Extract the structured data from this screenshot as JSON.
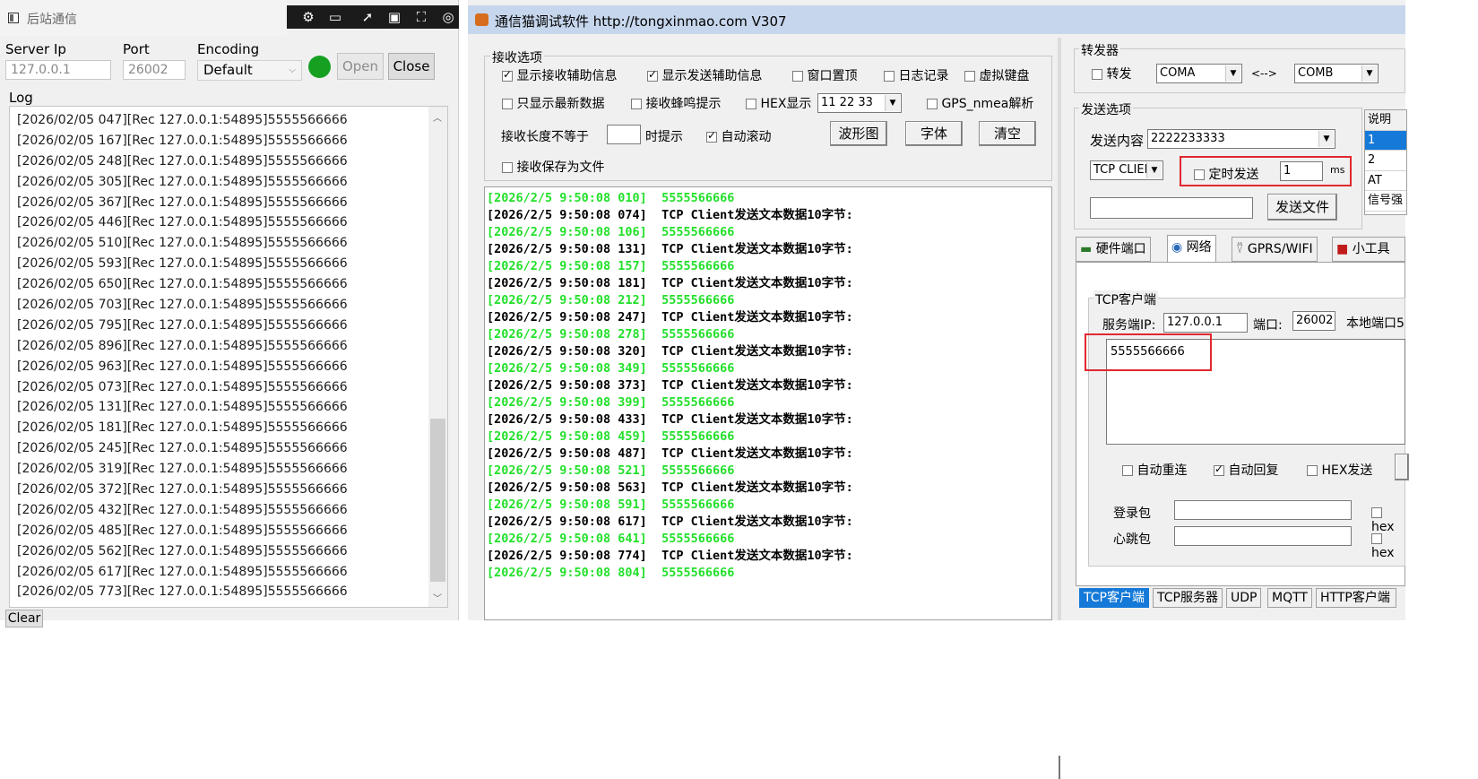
{
  "left_window": {
    "title": "后站通信",
    "server_ip_label": "Server Ip",
    "server_ip_value": "127.0.0.1",
    "port_label": "Port",
    "port_value": "26002",
    "encoding_label": "Encoding",
    "encoding_value": "Default",
    "status_color": "#16a022",
    "open_label": "Open",
    "close_label": "Close",
    "log_label": "Log",
    "clear_label": "Clear",
    "log_lines": [
      "[2026/02/05 047][Rec 127.0.0.1:54895]5555566666",
      "[2026/02/05 167][Rec 127.0.0.1:54895]5555566666",
      "[2026/02/05 248][Rec 127.0.0.1:54895]5555566666",
      "[2026/02/05 305][Rec 127.0.0.1:54895]5555566666",
      "[2026/02/05 367][Rec 127.0.0.1:54895]5555566666",
      "[2026/02/05 446][Rec 127.0.0.1:54895]5555566666",
      "[2026/02/05 510][Rec 127.0.0.1:54895]5555566666",
      "[2026/02/05 593][Rec 127.0.0.1:54895]5555566666",
      "[2026/02/05 650][Rec 127.0.0.1:54895]5555566666",
      "[2026/02/05 703][Rec 127.0.0.1:54895]5555566666",
      "[2026/02/05 795][Rec 127.0.0.1:54895]5555566666",
      "[2026/02/05 896][Rec 127.0.0.1:54895]5555566666",
      "[2026/02/05 963][Rec 127.0.0.1:54895]5555566666",
      "[2026/02/05 073][Rec 127.0.0.1:54895]5555566666",
      "[2026/02/05 131][Rec 127.0.0.1:54895]5555566666",
      "[2026/02/05 181][Rec 127.0.0.1:54895]5555566666",
      "[2026/02/05 245][Rec 127.0.0.1:54895]5555566666",
      "[2026/02/05 319][Rec 127.0.0.1:54895]5555566666",
      "[2026/02/05 372][Rec 127.0.0.1:54895]5555566666",
      "[2026/02/05 432][Rec 127.0.0.1:54895]5555566666",
      "[2026/02/05 485][Rec 127.0.0.1:54895]5555566666",
      "[2026/02/05 562][Rec 127.0.0.1:54895]5555566666",
      "[2026/02/05 617][Rec 127.0.0.1:54895]5555566666",
      "[2026/02/05 773][Rec 127.0.0.1:54895]5555566666"
    ]
  },
  "right_window": {
    "title": "通信猫调试软件  http://tongxinmao.com  V307",
    "recv_options": {
      "group_label": "接收选项",
      "show_recv_info": "显示接收辅助信息",
      "show_send_info": "显示发送辅助信息",
      "window_top": "窗口置顶",
      "log_record": "日志记录",
      "virtual_keyboard": "虚拟键盘",
      "only_latest": "只显示最新数据",
      "recv_beep": "接收蜂鸣提示",
      "hex_show": "HEX显示",
      "hex_value": "11 22 33",
      "gps_parse": "GPS_nmea解析",
      "recv_len_prefix": "接收长度不等于",
      "recv_len_suffix": "时提示",
      "auto_scroll": "自动滚动",
      "waveform": "波形图",
      "font": "字体",
      "clear": "清空",
      "save_file": "接收保存为文件"
    },
    "recv_lines": [
      {
        "ts": "[2026/2/5 9:50:08 010]",
        "msg": "5555566666",
        "color": "green"
      },
      {
        "ts": "[2026/2/5 9:50:08 074]",
        "msg": "TCP Client发送文本数据10字节:",
        "color": "black"
      },
      {
        "ts": "[2026/2/5 9:50:08 106]",
        "msg": "5555566666",
        "color": "green"
      },
      {
        "ts": "[2026/2/5 9:50:08 131]",
        "msg": "TCP Client发送文本数据10字节:",
        "color": "black"
      },
      {
        "ts": "[2026/2/5 9:50:08 157]",
        "msg": "5555566666",
        "color": "green"
      },
      {
        "ts": "[2026/2/5 9:50:08 181]",
        "msg": "TCP Client发送文本数据10字节:",
        "color": "black"
      },
      {
        "ts": "[2026/2/5 9:50:08 212]",
        "msg": "5555566666",
        "color": "green"
      },
      {
        "ts": "[2026/2/5 9:50:08 247]",
        "msg": "TCP Client发送文本数据10字节:",
        "color": "black"
      },
      {
        "ts": "[2026/2/5 9:50:08 278]",
        "msg": "5555566666",
        "color": "green"
      },
      {
        "ts": "[2026/2/5 9:50:08 320]",
        "msg": "TCP Client发送文本数据10字节:",
        "color": "black"
      },
      {
        "ts": "[2026/2/5 9:50:08 349]",
        "msg": "5555566666",
        "color": "green"
      },
      {
        "ts": "[2026/2/5 9:50:08 373]",
        "msg": "TCP Client发送文本数据10字节:",
        "color": "black"
      },
      {
        "ts": "[2026/2/5 9:50:08 399]",
        "msg": "5555566666",
        "color": "green"
      },
      {
        "ts": "[2026/2/5 9:50:08 433]",
        "msg": "TCP Client发送文本数据10字节:",
        "color": "black"
      },
      {
        "ts": "[2026/2/5 9:50:08 459]",
        "msg": "5555566666",
        "color": "green"
      },
      {
        "ts": "[2026/2/5 9:50:08 487]",
        "msg": "TCP Client发送文本数据10字节:",
        "color": "black"
      },
      {
        "ts": "[2026/2/5 9:50:08 521]",
        "msg": "5555566666",
        "color": "green"
      },
      {
        "ts": "[2026/2/5 9:50:08 563]",
        "msg": "TCP Client发送文本数据10字节:",
        "color": "black"
      },
      {
        "ts": "[2026/2/5 9:50:08 591]",
        "msg": "5555566666",
        "color": "green"
      },
      {
        "ts": "[2026/2/5 9:50:08 617]",
        "msg": "TCP Client发送文本数据10字节:",
        "color": "black"
      },
      {
        "ts": "[2026/2/5 9:50:08 641]",
        "msg": "5555566666",
        "color": "green"
      },
      {
        "ts": "[2026/2/5 9:50:08 774]",
        "msg": "TCP Client发送文本数据10字节:",
        "color": "black"
      },
      {
        "ts": "[2026/2/5 9:50:08 804]",
        "msg": "5555566666",
        "color": "green"
      }
    ],
    "forwarder": {
      "group_label": "转发器",
      "forward": "转发",
      "com_a": "COMA",
      "arrow": "<-->",
      "com_b": "COMB"
    },
    "send_options": {
      "group_label": "发送选项",
      "content_label": "发送内容",
      "content_value": "2222233333",
      "mode_value": "TCP CLIENT",
      "timed_send": "定时发送",
      "interval": "1",
      "unit": "ms",
      "send_file": "发送文件"
    },
    "desc_list": {
      "header": "说明",
      "items": [
        "1",
        "2",
        "AT",
        "信号强"
      ]
    },
    "mid_tabs": [
      "硬件端口",
      "网络",
      "GPRS/WIFI",
      "小工具"
    ],
    "tcp_client": {
      "group_label": "TCP客户端",
      "server_ip_label": "服务端IP:",
      "server_ip": "127.0.0.1",
      "port_label": "端口:",
      "port": "26002",
      "local_port_label": "本地端口5",
      "text": "5555566666",
      "auto_reconnect": "自动重连",
      "auto_reply": "自动回复",
      "hex_send": "HEX发送",
      "login_label": "登录包",
      "heartbeat_label": "心跳包",
      "hex_short": "hex"
    },
    "bottom_tabs": [
      "TCP客户端",
      "TCP服务器",
      "UDP",
      "MQTT",
      "HTTP客户端"
    ]
  }
}
